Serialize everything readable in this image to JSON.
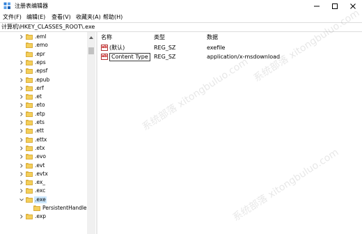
{
  "window": {
    "title": "注册表编辑器",
    "icon": "registry-editor-icon",
    "controls": [
      "minimize-icon",
      "maximize-icon",
      "close-icon"
    ]
  },
  "menu": [
    "文件(F)",
    "编辑(E)",
    "查看(V)",
    "收藏夹(A)",
    "帮助(H)"
  ],
  "address": "计算机\\HKEY_CLASSES_ROOT\\.exe",
  "tree": {
    "items": [
      {
        "label": ".eml",
        "expandable": true
      },
      {
        "label": ".emo",
        "expandable": false
      },
      {
        "label": ".epr",
        "expandable": false
      },
      {
        "label": ".eps",
        "expandable": true
      },
      {
        "label": ".epsf",
        "expandable": true
      },
      {
        "label": ".epub",
        "expandable": true
      },
      {
        "label": ".erf",
        "expandable": true
      },
      {
        "label": ".et",
        "expandable": true
      },
      {
        "label": ".eto",
        "expandable": true
      },
      {
        "label": ".etp",
        "expandable": true
      },
      {
        "label": ".ets",
        "expandable": true
      },
      {
        "label": ".ett",
        "expandable": true
      },
      {
        "label": ".ettx",
        "expandable": true
      },
      {
        "label": ".etx",
        "expandable": true
      },
      {
        "label": ".evo",
        "expandable": true
      },
      {
        "label": ".evt",
        "expandable": true
      },
      {
        "label": ".evtx",
        "expandable": true
      },
      {
        "label": ".ex_",
        "expandable": true
      },
      {
        "label": ".exc",
        "expandable": true
      },
      {
        "label": ".exe",
        "expandable": true,
        "expanded": true,
        "selected": true
      },
      {
        "label": "PersistentHandler",
        "expandable": false,
        "child": true
      },
      {
        "label": ".exp",
        "expandable": true
      }
    ]
  },
  "values": {
    "headers": {
      "name": "名称",
      "type": "类型",
      "data": "数据"
    },
    "rows": [
      {
        "name": "(默认)",
        "type": "REG_SZ",
        "data": "exefile",
        "icon": "string-value-icon"
      },
      {
        "name": "Content Type",
        "type": "REG_SZ",
        "data": "application/x-msdownload",
        "icon": "string-value-icon"
      }
    ],
    "icon_text": "ab"
  },
  "watermark": "系统部落 xitongbuluo.com"
}
